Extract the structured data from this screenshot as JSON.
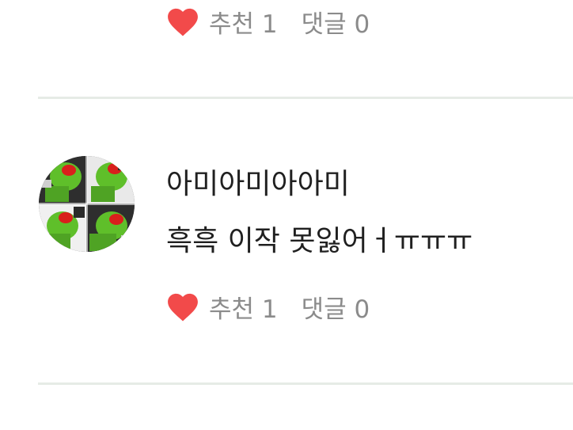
{
  "colors": {
    "heart": "#f24a4a",
    "meta_text": "#8b8b8b",
    "divider": "#e6ebe6",
    "body_text": "#202020"
  },
  "previous_comment": {
    "like_label": "추천 1",
    "comment_label": "댓글 0",
    "like_icon": "heart-icon"
  },
  "comment": {
    "avatar": "frog-avatar-collage",
    "username": "아미아미아아미",
    "text": "흑흑 이작 못잃어ㅓㅠㅠㅠ",
    "like_label": "추천 1",
    "comment_label": "댓글 0",
    "like_icon": "heart-icon"
  }
}
